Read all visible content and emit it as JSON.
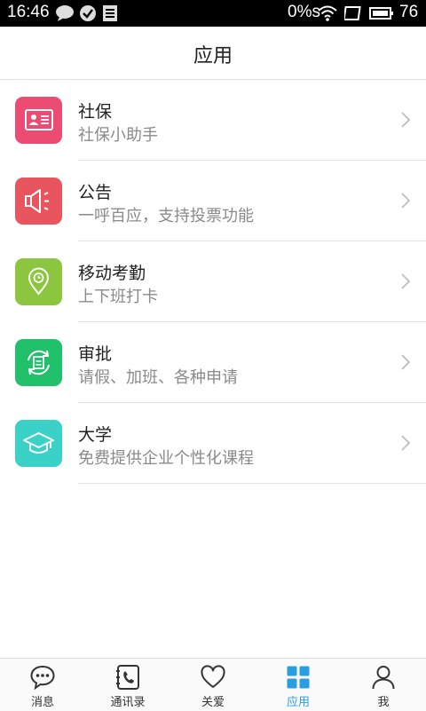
{
  "status_bar": {
    "time": "16:46",
    "data_rate": "0%s",
    "battery": "76"
  },
  "header": {
    "title": "应用"
  },
  "apps": [
    {
      "name": "社保",
      "desc": "社保小助手",
      "icon": "id-card-icon",
      "color": "#ec4c72"
    },
    {
      "name": "公告",
      "desc": "一呼百应，支持投票功能",
      "icon": "speaker-icon",
      "color": "#e9555f"
    },
    {
      "name": "移动考勤",
      "desc": "上下班打卡",
      "icon": "location-pin-icon",
      "color": "#8cc63e"
    },
    {
      "name": "审批",
      "desc": "请假、加班、各种申请",
      "icon": "approval-refresh-icon",
      "color": "#21c16b"
    },
    {
      "name": "大学",
      "desc": "免费提供企业个性化课程",
      "icon": "graduation-cap-icon",
      "color": "#3ad2c6"
    }
  ],
  "tabs": [
    {
      "label": "消息",
      "icon": "chat-bubble-icon",
      "active": false
    },
    {
      "label": "通讯录",
      "icon": "contacts-icon",
      "active": false
    },
    {
      "label": "关爱",
      "icon": "heart-icon",
      "active": false
    },
    {
      "label": "应用",
      "icon": "apps-grid-icon",
      "active": true
    },
    {
      "label": "我",
      "icon": "person-icon",
      "active": false
    }
  ],
  "colors": {
    "accent": "#2a9fe0",
    "tab_inactive": "#333333"
  }
}
